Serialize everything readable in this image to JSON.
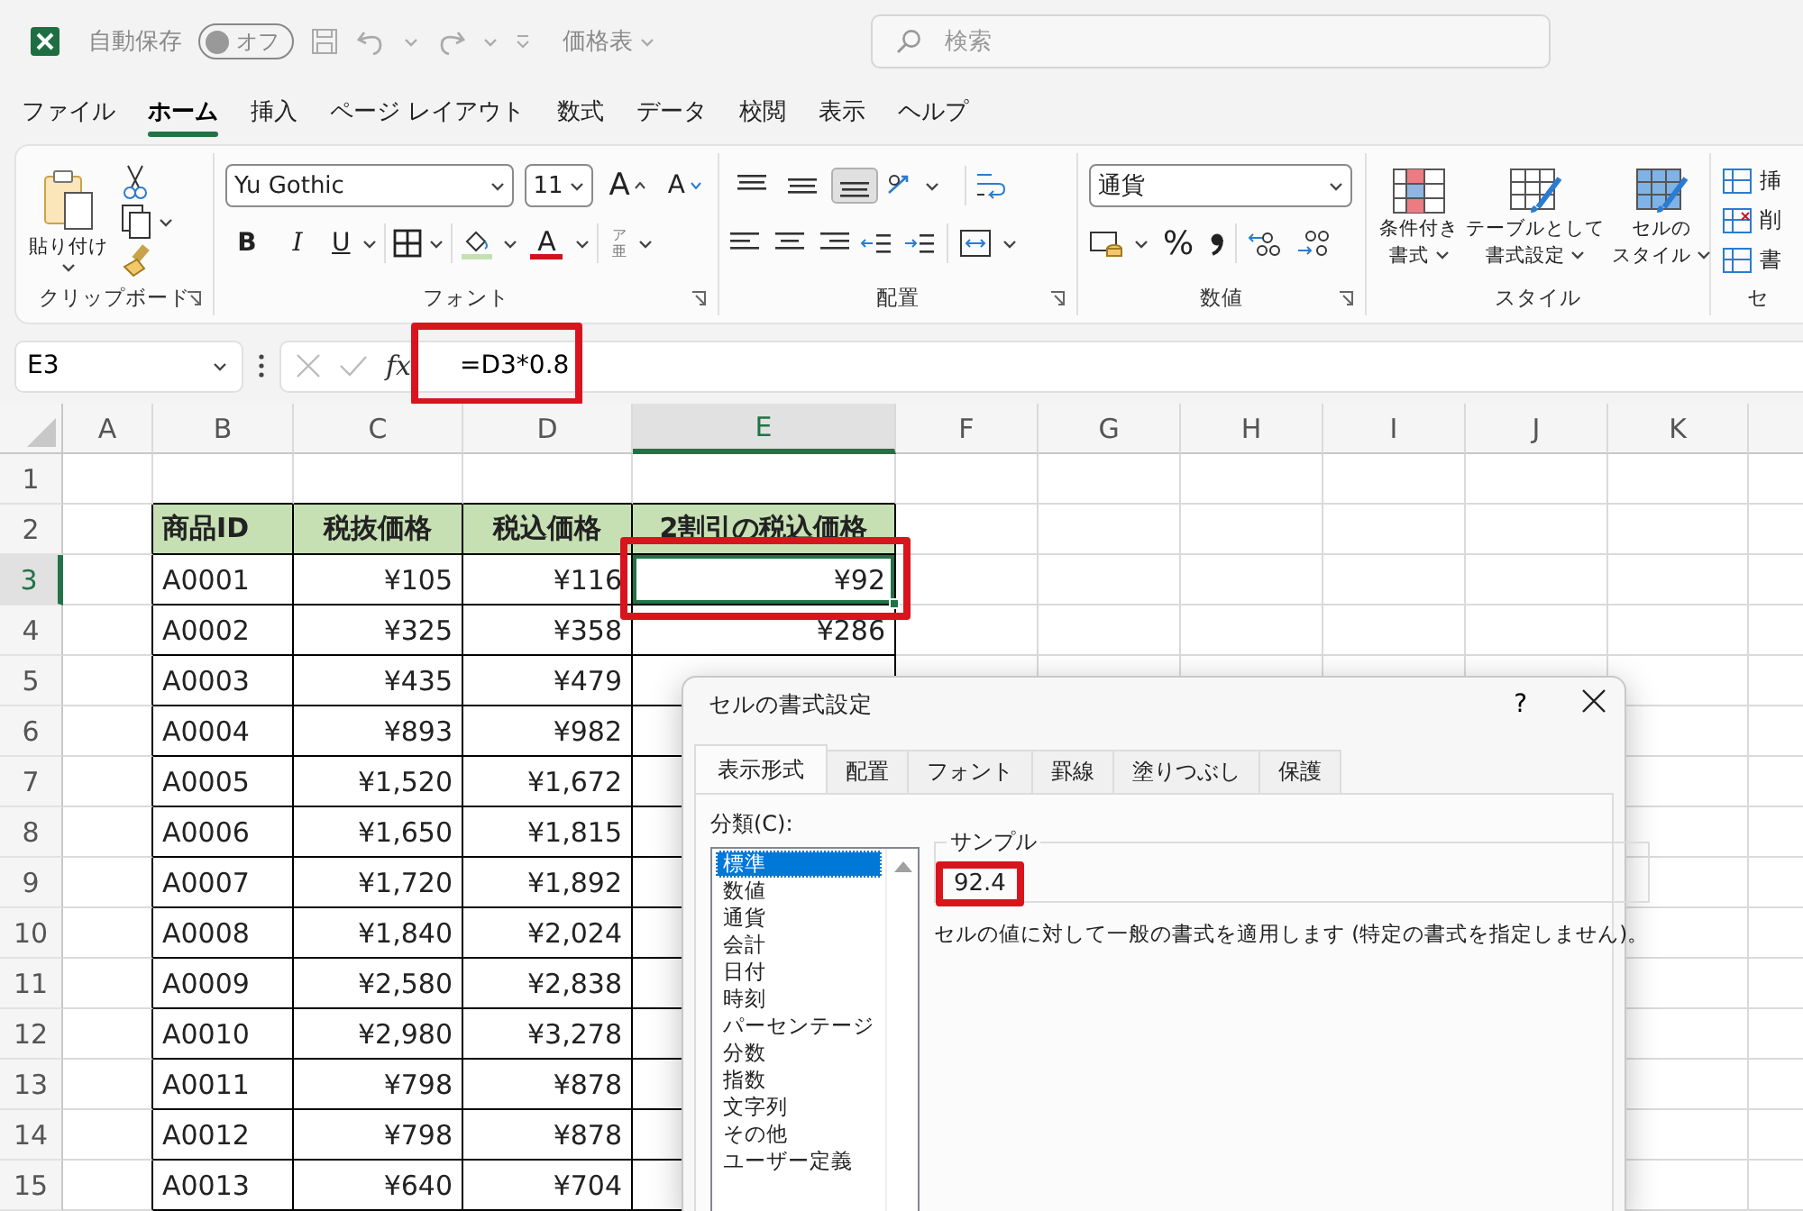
{
  "title_bar": {
    "autosave_label": "自動保存",
    "autosave_toggle": {
      "label": "オフ",
      "on": false
    },
    "file_name": "価格表",
    "search": {
      "placeholder": "検索"
    }
  },
  "menu_tabs": [
    {
      "label": "ファイル",
      "selected": false
    },
    {
      "label": "ホーム",
      "selected": true
    },
    {
      "label": "挿入",
      "selected": false
    },
    {
      "label": "ページ レイアウト",
      "selected": false
    },
    {
      "label": "数式",
      "selected": false
    },
    {
      "label": "データ",
      "selected": false
    },
    {
      "label": "校閲",
      "selected": false
    },
    {
      "label": "表示",
      "selected": false
    },
    {
      "label": "ヘルプ",
      "selected": false
    }
  ],
  "ribbon": {
    "clipboard": {
      "paste_label": "貼り付け",
      "group_label": "クリップボード"
    },
    "font": {
      "font_name": "Yu Gothic",
      "font_size": "11",
      "grow_font": "A",
      "shrink_font": "A",
      "bold": "B",
      "italic": "I",
      "underline": "U",
      "font_color": "A",
      "phonetic_top": "ア",
      "phonetic_bottom": "亜",
      "group_label": "フォント"
    },
    "alignment": {
      "vertical_align": [
        {
          "selected": false
        },
        {
          "selected": false
        },
        {
          "selected": true
        }
      ],
      "group_label": "配置"
    },
    "number": {
      "format": "通貨",
      "percent": "%",
      "group_label": "数値"
    },
    "styles": {
      "buttons": [
        {
          "lines": [
            "条件付き",
            "書式"
          ]
        },
        {
          "lines": [
            "テーブルとして",
            "書式設定"
          ]
        },
        {
          "lines": [
            "セルの",
            "スタイル"
          ]
        }
      ],
      "group_label": "スタイル"
    },
    "cells": {
      "buttons": [
        "挿",
        "削",
        "書"
      ],
      "group_label": "セ"
    }
  },
  "formula_bar": {
    "name_box": "E3",
    "fx": "fx",
    "formula": "=D3*0.8"
  },
  "sheet": {
    "columns": [
      {
        "label": "A",
        "selected": false
      },
      {
        "label": "B",
        "selected": false
      },
      {
        "label": "C",
        "selected": false
      },
      {
        "label": "D",
        "selected": false
      },
      {
        "label": "E",
        "selected": true
      },
      {
        "label": "F",
        "selected": false
      },
      {
        "label": "G",
        "selected": false
      },
      {
        "label": "H",
        "selected": false
      },
      {
        "label": "I",
        "selected": false
      },
      {
        "label": "J",
        "selected": false
      },
      {
        "label": "K",
        "selected": false
      }
    ],
    "rows": [
      {
        "label": "1",
        "selected": false
      },
      {
        "label": "2",
        "selected": false
      },
      {
        "label": "3",
        "selected": true
      },
      {
        "label": "4",
        "selected": false
      },
      {
        "label": "5",
        "selected": false
      },
      {
        "label": "6",
        "selected": false
      },
      {
        "label": "7",
        "selected": false
      },
      {
        "label": "8",
        "selected": false
      },
      {
        "label": "9",
        "selected": false
      },
      {
        "label": "10",
        "selected": false
      },
      {
        "label": "11",
        "selected": false
      },
      {
        "label": "12",
        "selected": false
      },
      {
        "label": "13",
        "selected": false
      },
      {
        "label": "14",
        "selected": false
      },
      {
        "label": "15",
        "selected": false
      }
    ],
    "table": {
      "header": [
        "商品ID",
        "税抜価格",
        "税込価格",
        "2割引の税込価格"
      ],
      "rows": [
        [
          "A0001",
          "¥105",
          "¥116",
          "¥92"
        ],
        [
          "A0002",
          "¥325",
          "¥358",
          "¥286"
        ],
        [
          "A0003",
          "¥435",
          "¥479"
        ],
        [
          "A0004",
          "¥893",
          "¥982"
        ],
        [
          "A0005",
          "¥1,520",
          "¥1,672"
        ],
        [
          "A0006",
          "¥1,650",
          "¥1,815"
        ],
        [
          "A0007",
          "¥1,720",
          "¥1,892"
        ],
        [
          "A0008",
          "¥1,840",
          "¥2,024"
        ],
        [
          "A0009",
          "¥2,580",
          "¥2,838"
        ],
        [
          "A0010",
          "¥2,980",
          "¥3,278"
        ],
        [
          "A0011",
          "¥798",
          "¥878"
        ],
        [
          "A0012",
          "¥798",
          "¥878"
        ],
        [
          "A0013",
          "¥640",
          "¥704"
        ]
      ]
    }
  },
  "dialog": {
    "title": "セルの書式設定",
    "help": "?",
    "tabs": [
      {
        "label": "表示形式",
        "selected": true
      },
      {
        "label": "配置",
        "selected": false
      },
      {
        "label": "フォント",
        "selected": false
      },
      {
        "label": "罫線",
        "selected": false
      },
      {
        "label": "塗りつぶし",
        "selected": false
      },
      {
        "label": "保護",
        "selected": false
      }
    ],
    "category_label": "分類(C):",
    "categories": [
      {
        "label": "標準",
        "selected": true
      },
      {
        "label": "数値",
        "selected": false
      },
      {
        "label": "通貨",
        "selected": false
      },
      {
        "label": "会計",
        "selected": false
      },
      {
        "label": "日付",
        "selected": false
      },
      {
        "label": "時刻",
        "selected": false
      },
      {
        "label": "パーセンテージ",
        "selected": false
      },
      {
        "label": "分数",
        "selected": false
      },
      {
        "label": "指数",
        "selected": false
      },
      {
        "label": "文字列",
        "selected": false
      },
      {
        "label": "その他",
        "selected": false
      },
      {
        "label": "ユーザー定義",
        "selected": false
      }
    ],
    "sample": {
      "legend": "サンプル",
      "value": "92.4"
    },
    "description": "セルの値に対して一般の書式を適用します (特定の書式を指定しません)。"
  }
}
